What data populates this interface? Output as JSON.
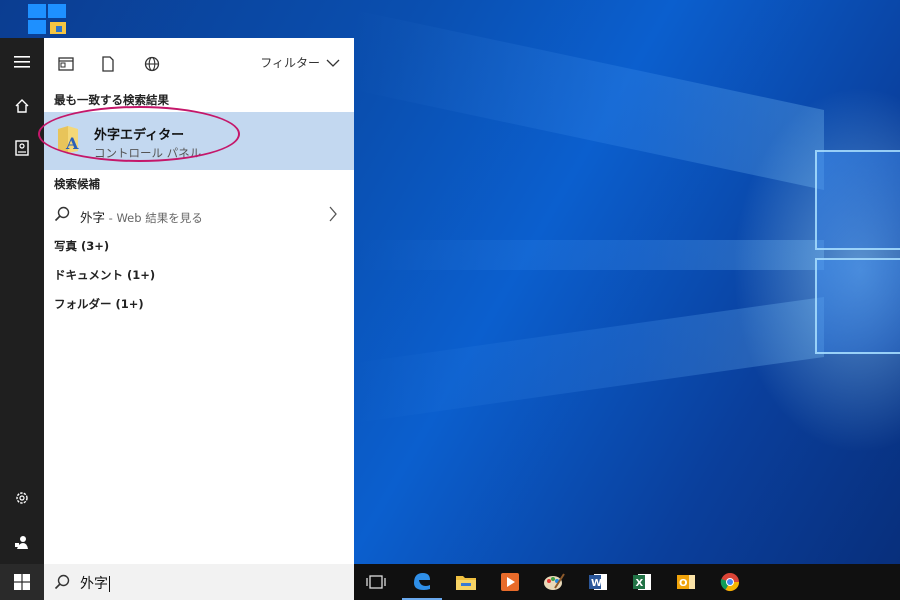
{
  "desktop": {
    "shortcut_icon": "windows-folder-shortcut-icon"
  },
  "rail": {
    "items": [
      {
        "name": "hamburger-menu-icon"
      },
      {
        "name": "home-icon"
      },
      {
        "name": "notebook-icon"
      },
      {
        "name": "settings-gear-icon"
      },
      {
        "name": "feedback-icon"
      }
    ]
  },
  "toolbar": {
    "icons": [
      "apps-filter-icon",
      "documents-filter-icon",
      "web-filter-icon"
    ],
    "filter_label": "フィルター"
  },
  "best_match": {
    "header": "最も一致する検索結果",
    "title": "外字エディター",
    "subtitle": "コントロール パネル"
  },
  "suggestions": {
    "header": "検索候補",
    "query": "外字",
    "web_suffix": " - Web 結果を見る"
  },
  "categories": [
    {
      "label": "写真 (3+)"
    },
    {
      "label": "ドキュメント (1+)"
    },
    {
      "label": "フォルダー (1+)"
    }
  ],
  "search": {
    "value": "外字"
  },
  "taskbar": {
    "apps": [
      "task-view-icon",
      "edge-icon",
      "file-explorer-icon",
      "media-player-icon",
      "paint-icon",
      "word-icon",
      "excel-icon",
      "outlook-icon",
      "chrome-icon"
    ]
  },
  "colors": {
    "accent": "#c3d8f0",
    "highlight_ring": "#c4176a",
    "rail": "#1f1f1f",
    "taskbar": "#101010"
  }
}
